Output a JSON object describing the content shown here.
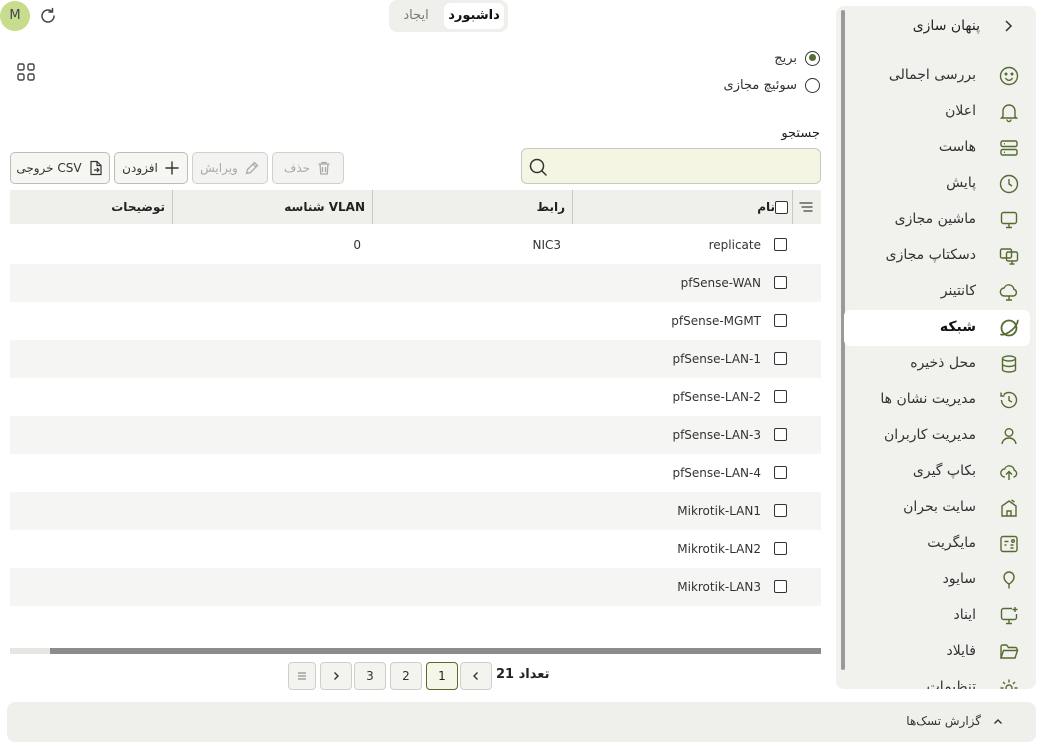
{
  "user": {
    "avatar_letter": "M"
  },
  "tabs": {
    "dashboard": "داشبورد",
    "create": "ایجاد"
  },
  "radio": {
    "bridge": "بریج",
    "vswitch": "سوئیچ مجازی",
    "selected": "bridge"
  },
  "search": {
    "label": "جستجو",
    "placeholder": "",
    "value": ""
  },
  "toolbar": {
    "csv": "خروجی CSV",
    "add": "افزودن",
    "edit": "ویرایش",
    "delete": "حذف"
  },
  "table": {
    "headers": {
      "name": "نام",
      "interface": "رابط",
      "vlan": "شناسه VLAN",
      "description": "توضیحات"
    },
    "rows": [
      {
        "name": "replicate",
        "interface": "NIC3",
        "vlan": "0",
        "description": ""
      },
      {
        "name": "pfSense-WAN",
        "interface": "",
        "vlan": "",
        "description": ""
      },
      {
        "name": "pfSense-MGMT",
        "interface": "",
        "vlan": "",
        "description": ""
      },
      {
        "name": "pfSense-LAN-1",
        "interface": "",
        "vlan": "",
        "description": ""
      },
      {
        "name": "pfSense-LAN-2",
        "interface": "",
        "vlan": "",
        "description": ""
      },
      {
        "name": "pfSense-LAN-3",
        "interface": "",
        "vlan": "",
        "description": ""
      },
      {
        "name": "pfSense-LAN-4",
        "interface": "",
        "vlan": "",
        "description": ""
      },
      {
        "name": "Mikrotik-LAN1",
        "interface": "",
        "vlan": "",
        "description": ""
      },
      {
        "name": "Mikrotik-LAN2",
        "interface": "",
        "vlan": "",
        "description": ""
      },
      {
        "name": "Mikrotik-LAN3",
        "interface": "",
        "vlan": "",
        "description": ""
      }
    ]
  },
  "pagination": {
    "total_label": "تعداد 21",
    "pages": [
      "1",
      "2",
      "3"
    ],
    "current": "1"
  },
  "sidebar": {
    "title": "پنهان سازی",
    "items": [
      {
        "label": "بررسی اجمالی",
        "icon": "smile-icon"
      },
      {
        "label": "اعلان",
        "icon": "bell-icon"
      },
      {
        "label": "هاست",
        "icon": "server-icon"
      },
      {
        "label": "پایش",
        "icon": "clock-chart-icon"
      },
      {
        "label": "ماشین مجازی",
        "icon": "monitor-icon"
      },
      {
        "label": "دسکتاپ مجازی",
        "icon": "desktops-icon"
      },
      {
        "label": "کانتینر",
        "icon": "cloud-icon"
      },
      {
        "label": "شبکه",
        "icon": "planet-icon"
      },
      {
        "label": "محل ذخیره",
        "icon": "database-icon"
      },
      {
        "label": "مدیریت نشان ها",
        "icon": "history-icon"
      },
      {
        "label": "مدیریت کاربران",
        "icon": "user-icon"
      },
      {
        "label": "بکاپ گیری",
        "icon": "cloud-upload-icon"
      },
      {
        "label": "سایت بحران",
        "icon": "building-icon"
      },
      {
        "label": "مایگریت",
        "icon": "migrate-icon"
      },
      {
        "label": "سایود",
        "icon": "balloon-icon"
      },
      {
        "label": "ایناد",
        "icon": "monitor-plus-icon"
      },
      {
        "label": "فایلاد",
        "icon": "folder-icon"
      },
      {
        "label": "تنظیمات",
        "icon": "settings-icon"
      }
    ],
    "active": "شبکه"
  },
  "footer": {
    "task_report": "گزارش تسک‌ها"
  },
  "colors": {
    "accent": "#556b2f",
    "avatar": "#c7dc8c",
    "search_bg": "#f4f5e2"
  }
}
